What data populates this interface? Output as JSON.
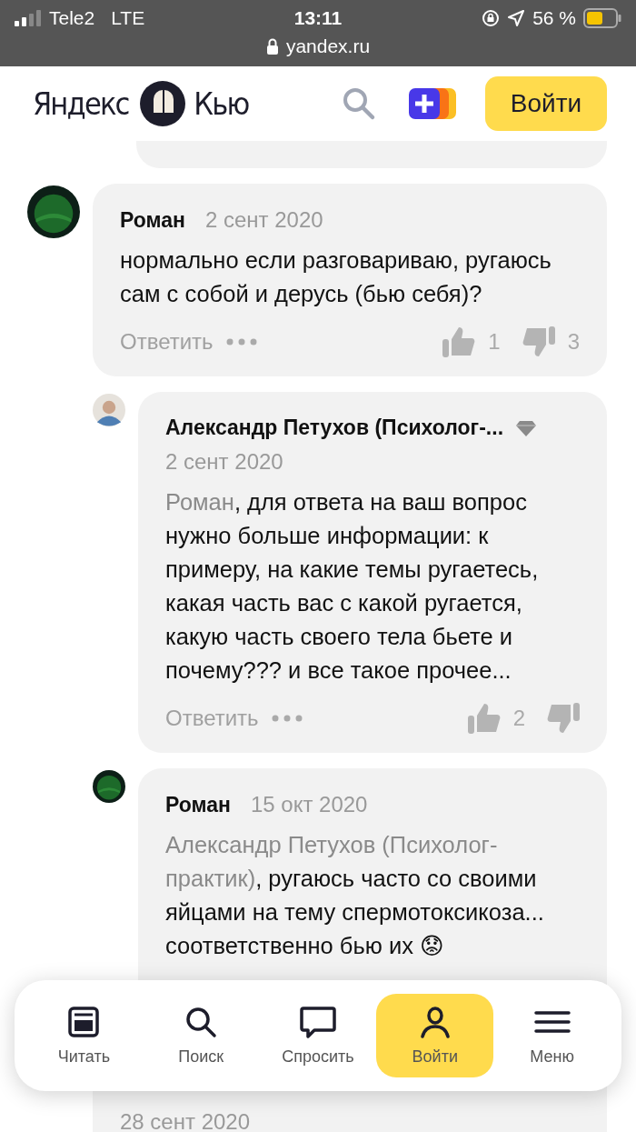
{
  "status_bar": {
    "carrier": "Tele2",
    "network": "LTE",
    "time": "13:11",
    "battery_text": "56 %"
  },
  "address_bar": {
    "url": "yandex.ru"
  },
  "header": {
    "logo_left": "Яндекс",
    "logo_right": "Кью",
    "login_button": "Войти"
  },
  "comments": [
    {
      "kind": "badge",
      "author": "Роман",
      "date": "2 сент 2020",
      "text": "нормально если разговариваю, ругаюсь сам с собой и дерусь (бью себя)?",
      "reply": "Ответить",
      "likes": "1",
      "dislikes": "3",
      "children": [
        {
          "kind": "portrait",
          "author": "Александр Петухов (Психолог-...",
          "verified": true,
          "date": "2 сент 2020",
          "mention": "Роман",
          "text": ", для ответа на ваш вопрос нужно больше информации: к примеру, на какие темы ругаетесь, какая часть вас с какой ругается, какую часть своего тела бьете и почему??? и все такое прочее...",
          "reply": "Ответить",
          "likes": "2"
        },
        {
          "kind": "badge",
          "author": "Роман",
          "date": "15 окт 2020",
          "mention": "Александр Петухов (Психолог-практик)",
          "text": ", ругаюсь часто со своими яйцами на тему спермотоксикоза... соответственно бью их 😟"
        }
      ]
    },
    {
      "date": "28 сент 2020"
    }
  ],
  "bottom_nav": [
    {
      "label": "Читать",
      "selected": false
    },
    {
      "label": "Поиск",
      "selected": false
    },
    {
      "label": "Спросить",
      "selected": false
    },
    {
      "label": "Войти",
      "selected": true
    },
    {
      "label": "Меню",
      "selected": false
    }
  ]
}
